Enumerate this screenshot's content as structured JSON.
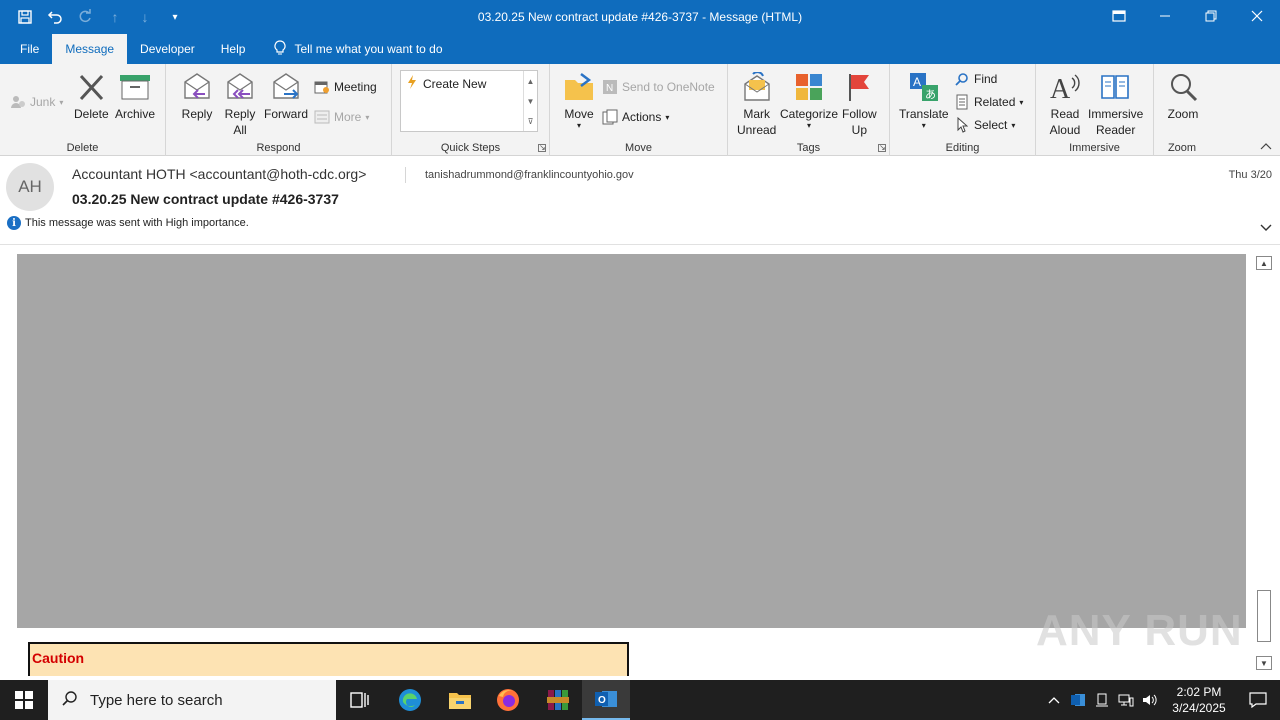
{
  "window": {
    "title": "03.20.25 New contract update #426-3737  -  Message (HTML)"
  },
  "menu": {
    "tabs": [
      "File",
      "Message",
      "Developer",
      "Help"
    ],
    "tell_me": "Tell me what you want to do"
  },
  "ribbon": {
    "delete_group": {
      "label": "Delete",
      "junk": "Junk",
      "delete": "Delete",
      "archive": "Archive"
    },
    "respond_group": {
      "label": "Respond",
      "reply": "Reply",
      "reply_all_1": "Reply",
      "reply_all_2": "All",
      "forward": "Forward",
      "meeting": "Meeting",
      "more": "More"
    },
    "quicksteps_group": {
      "label": "Quick Steps",
      "create_new": "Create New"
    },
    "move_group": {
      "label": "Move",
      "move": "Move",
      "send_onenote": "Send to OneNote",
      "actions": "Actions"
    },
    "tags_group": {
      "label": "Tags",
      "mark_unread_1": "Mark",
      "mark_unread_2": "Unread",
      "categorize": "Categorize",
      "follow_up_1": "Follow",
      "follow_up_2": "Up"
    },
    "editing_group": {
      "label": "Editing",
      "translate": "Translate",
      "find": "Find",
      "related": "Related",
      "select": "Select"
    },
    "immersive_group": {
      "label": "Immersive",
      "read_aloud_1": "Read",
      "read_aloud_2": "Aloud",
      "immersive_reader_1": "Immersive",
      "immersive_reader_2": "Reader"
    },
    "zoom_group": {
      "label": "Zoom",
      "zoom": "Zoom"
    }
  },
  "message": {
    "avatar_initials": "AH",
    "from": "Accountant HOTH <accountant@hoth-cdc.org>",
    "to": "tanishadrummond@franklincountyohio.gov",
    "date": "Thu 3/20",
    "subject": "03.20.25 New contract update #426-3737",
    "importance": "This message was sent with High importance.",
    "caution_label": "Caution"
  },
  "watermark": "ANY RUN",
  "taskbar": {
    "search_placeholder": "Type here to search",
    "time": "2:02 PM",
    "date": "3/24/2025"
  },
  "colors": {
    "accent": "#0f6cbd",
    "caution_bg": "#fde3b3",
    "caution_text": "#d40000",
    "body_image": "#a6a6a6"
  }
}
